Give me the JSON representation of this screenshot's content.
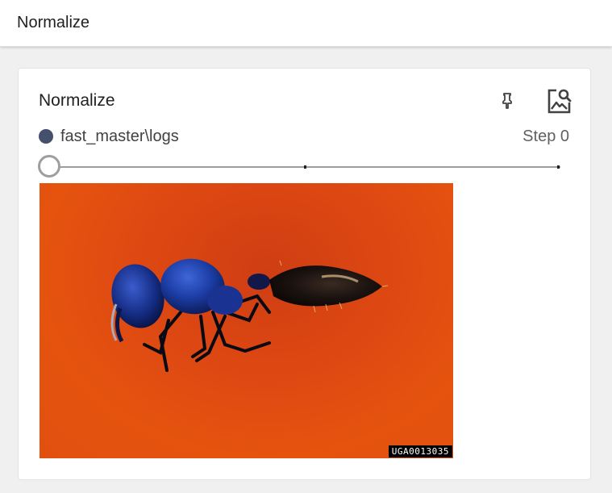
{
  "header": {
    "title": "Normalize"
  },
  "card": {
    "title": "Normalize",
    "run_name": "fast_master\\logs",
    "run_color": "#45506d",
    "step_label": "Step 0",
    "slider_value_fraction": 0,
    "actions": {
      "pin_icon": "pin-icon",
      "image_zoom_icon": "image-search-icon"
    },
    "image": {
      "subject": "blue and black ant specimen on orange background",
      "watermark": "UGA0013035"
    }
  }
}
